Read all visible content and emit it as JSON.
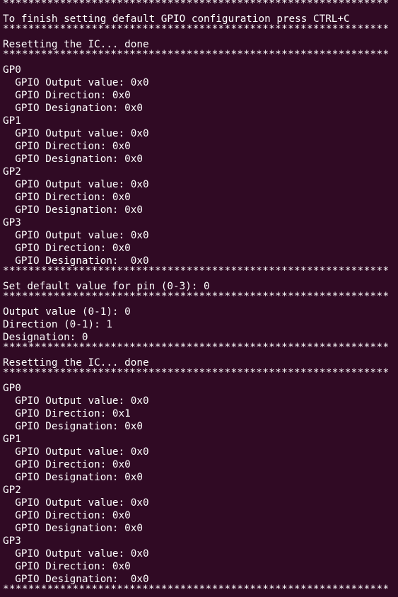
{
  "terminal": {
    "background": "#300a24",
    "foreground": "#ffffff",
    "lines": [
      {
        "kind": "sep",
        "text": "*************************************************************"
      },
      {
        "kind": "text",
        "text": "To finish setting default GPIO configuration press CTRL+C"
      },
      {
        "kind": "sep",
        "text": "*************************************************************"
      },
      {
        "kind": "text",
        "text": "Resetting the IC... done"
      },
      {
        "kind": "sep",
        "text": "*************************************************************"
      },
      {
        "kind": "text",
        "text": "GP0"
      },
      {
        "kind": "text",
        "text": "  GPIO Output value: 0x0"
      },
      {
        "kind": "text",
        "text": "  GPIO Direction: 0x0"
      },
      {
        "kind": "text",
        "text": "  GPIO Designation: 0x0"
      },
      {
        "kind": "text",
        "text": "GP1"
      },
      {
        "kind": "text",
        "text": "  GPIO Output value: 0x0"
      },
      {
        "kind": "text",
        "text": "  GPIO Direction: 0x0"
      },
      {
        "kind": "text",
        "text": "  GPIO Designation: 0x0"
      },
      {
        "kind": "text",
        "text": "GP2"
      },
      {
        "kind": "text",
        "text": "  GPIO Output value: 0x0"
      },
      {
        "kind": "text",
        "text": "  GPIO Direction: 0x0"
      },
      {
        "kind": "text",
        "text": "  GPIO Designation: 0x0"
      },
      {
        "kind": "text",
        "text": "GP3"
      },
      {
        "kind": "text",
        "text": "  GPIO Output value: 0x0"
      },
      {
        "kind": "text",
        "text": "  GPIO Direction: 0x0"
      },
      {
        "kind": "text",
        "text": "  GPIO Designation:  0x0"
      },
      {
        "kind": "sep",
        "text": "*************************************************************"
      },
      {
        "kind": "text",
        "text": "Set default value for pin (0-3): 0"
      },
      {
        "kind": "sep",
        "text": "*************************************************************"
      },
      {
        "kind": "text",
        "text": "Output value (0-1): 0"
      },
      {
        "kind": "text",
        "text": "Direction (0-1): 1"
      },
      {
        "kind": "text",
        "text": "Designation: 0"
      },
      {
        "kind": "sep",
        "text": "*************************************************************"
      },
      {
        "kind": "text",
        "text": "Resetting the IC... done"
      },
      {
        "kind": "sep",
        "text": "*************************************************************"
      },
      {
        "kind": "text",
        "text": "GP0"
      },
      {
        "kind": "text",
        "text": "  GPIO Output value: 0x0"
      },
      {
        "kind": "text",
        "text": "  GPIO Direction: 0x1"
      },
      {
        "kind": "text",
        "text": "  GPIO Designation: 0x0"
      },
      {
        "kind": "text",
        "text": "GP1"
      },
      {
        "kind": "text",
        "text": "  GPIO Output value: 0x0"
      },
      {
        "kind": "text",
        "text": "  GPIO Direction: 0x0"
      },
      {
        "kind": "text",
        "text": "  GPIO Designation: 0x0"
      },
      {
        "kind": "text",
        "text": "GP2"
      },
      {
        "kind": "text",
        "text": "  GPIO Output value: 0x0"
      },
      {
        "kind": "text",
        "text": "  GPIO Direction: 0x0"
      },
      {
        "kind": "text",
        "text": "  GPIO Designation: 0x0"
      },
      {
        "kind": "text",
        "text": "GP3"
      },
      {
        "kind": "text",
        "text": "  GPIO Output value: 0x0"
      },
      {
        "kind": "text",
        "text": "  GPIO Direction: 0x0"
      },
      {
        "kind": "text",
        "text": "  GPIO Designation:  0x0"
      },
      {
        "kind": "sep",
        "text": "*************************************************************"
      }
    ]
  }
}
